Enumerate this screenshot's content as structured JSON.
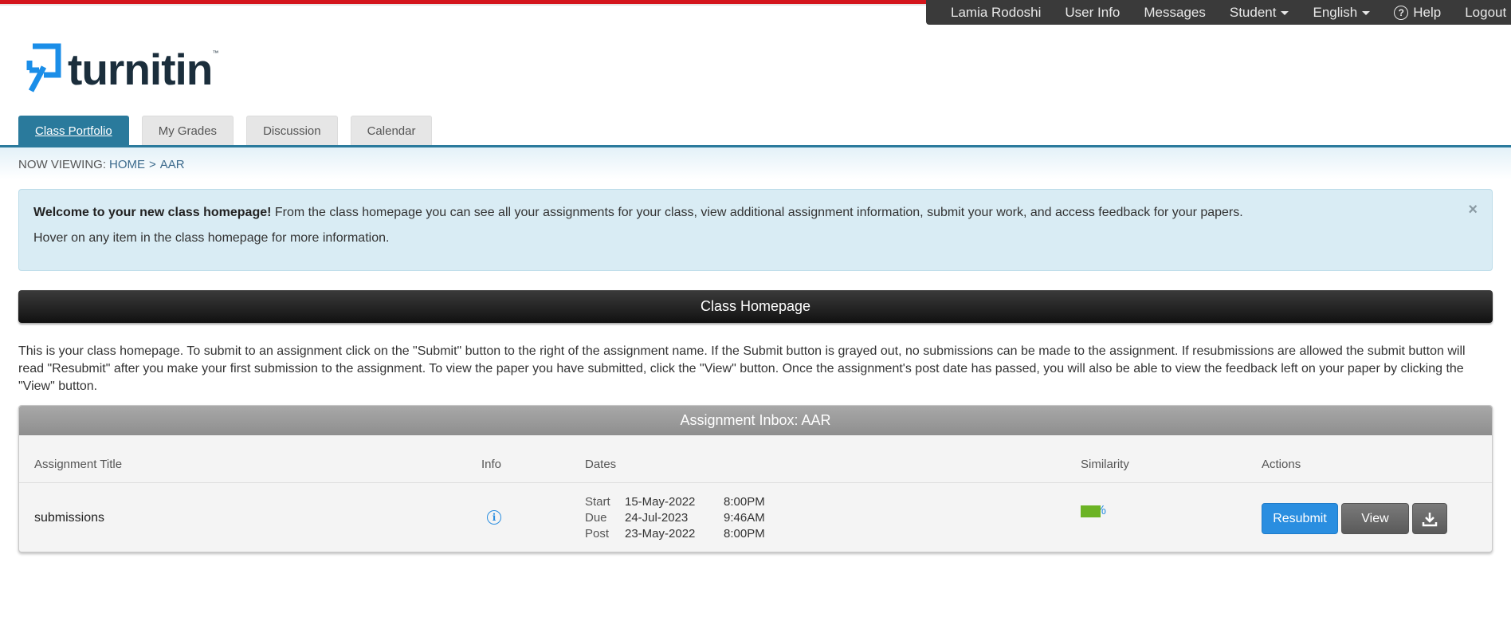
{
  "top_nav": {
    "user_name": "Lamia Rodoshi",
    "user_info": "User Info",
    "messages": "Messages",
    "role": "Student",
    "language": "English",
    "help": "Help",
    "logout": "Logout"
  },
  "brand": {
    "name": "turnitin",
    "tm": "™",
    "colors": {
      "stripe_red": "#d4151c",
      "accent_blue": "#2a7a9c",
      "logo_blue": "#1b8ee8"
    }
  },
  "tabs": [
    {
      "label": "Class Portfolio",
      "active": true
    },
    {
      "label": "My Grades",
      "active": false
    },
    {
      "label": "Discussion",
      "active": false
    },
    {
      "label": "Calendar",
      "active": false
    }
  ],
  "breadcrumb": {
    "label": "NOW VIEWING:",
    "home": "HOME",
    "separator": ">",
    "current": "AAR"
  },
  "welcome": {
    "bold": "Welcome to your new class homepage!",
    "text": " From the class homepage you can see all your assignments for your class, view additional assignment information, submit your work, and access feedback for your papers.",
    "hint": "Hover on any item in the class homepage for more information.",
    "close": "×"
  },
  "class_homepage": {
    "title": "Class Homepage",
    "intro": "This is your class homepage. To submit to an assignment click on the \"Submit\" button to the right of the assignment name. If the Submit button is grayed out, no submissions can be made to the assignment. If resubmissions are allowed the submit button will read \"Resubmit\" after you make your first submission to the assignment. To view the paper you have submitted, click the \"View\" button. Once the assignment's post date has passed, you will also be able to view the feedback left on your paper by clicking the \"View\" button."
  },
  "inbox": {
    "title": "Assignment Inbox: AAR",
    "columns": {
      "title": "Assignment Title",
      "info": "Info",
      "dates": "Dates",
      "similarity": "Similarity",
      "actions": "Actions"
    },
    "rows": [
      {
        "title": "submissions",
        "info_icon": "info-icon",
        "dates": [
          {
            "label": "Start",
            "date": "15-May-2022",
            "time": "8:00PM"
          },
          {
            "label": "Due",
            "date": "24-Jul-2023",
            "time": "9:46AM"
          },
          {
            "label": "Post",
            "date": "23-May-2022",
            "time": "8:00PM"
          }
        ],
        "similarity": "22%",
        "similarity_color": "#6bb324",
        "actions": {
          "resubmit": "Resubmit",
          "view": "View",
          "download_icon": "download-icon"
        }
      }
    ]
  }
}
